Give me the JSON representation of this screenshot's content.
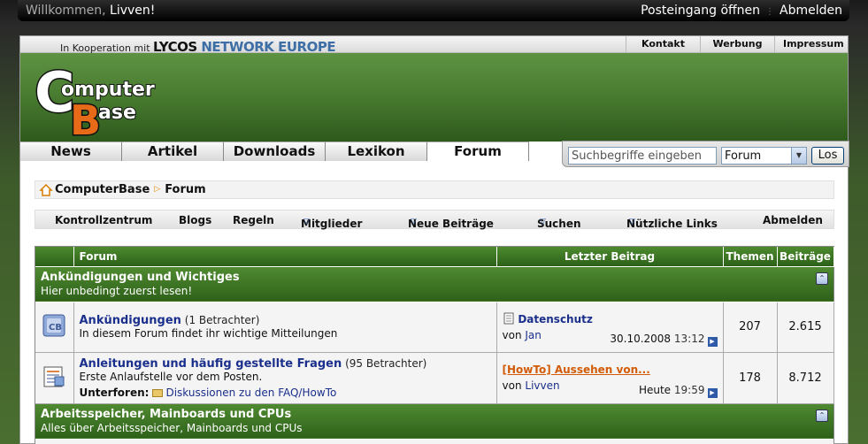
{
  "topbar": {
    "welcome_prefix": "Willkommen,",
    "username": "Livven!",
    "inbox": "Posteingang öffnen",
    "logout": "Abmelden"
  },
  "lycos": {
    "koop": "In Kooperation mit",
    "brand1": "LYCOS",
    "brand2": "NETWORK EUROPE",
    "links": [
      "Kontakt",
      "Werbung",
      "Impressum"
    ]
  },
  "logo": {
    "line1": "omputer",
    "line2": "ase",
    "c": "C",
    "b": "B"
  },
  "nav": {
    "tabs": [
      "News",
      "Artikel",
      "Downloads",
      "Lexikon",
      "Forum"
    ],
    "active": 4
  },
  "search": {
    "placeholder": "Suchbegriffe eingeben",
    "scope": "Forum",
    "button": "Los"
  },
  "breadcrumb": {
    "root": "ComputerBase",
    "current": "Forum"
  },
  "subnav": {
    "items": [
      "Kontrollzentrum",
      "Blogs",
      "Regeln",
      "Mitglieder",
      "Neue Beiträge",
      "Suchen",
      "Nützliche Links",
      "Abmelden"
    ]
  },
  "table": {
    "headers": {
      "forum": "Forum",
      "last": "Letzter Beitrag",
      "threads": "Themen",
      "posts": "Beiträge"
    },
    "categories": [
      {
        "title": "Ankündigungen und Wichtiges",
        "desc": "Hier unbedingt zuerst lesen!"
      },
      {
        "title": "Arbeitsspeicher, Mainboards und CPUs",
        "desc": "Alles über Arbeitsspeicher, Mainboards und CPUs"
      }
    ],
    "forums": [
      {
        "title": "Ankündigungen",
        "viewers": "(1 Betrachter)",
        "desc": "In diesem Forum findet ihr wichtige Mitteilungen",
        "last_title": "Datenschutz",
        "last_by_prefix": "von",
        "last_by": "Jan",
        "last_date": "30.10.2008",
        "last_time": "13:12",
        "threads": "207",
        "posts": "2.615"
      },
      {
        "title": "Anleitungen und häufig gestellte Fragen",
        "viewers": "(95 Betrachter)",
        "desc": "Erste Anlaufstelle vor dem Posten.",
        "subforen_label": "Unterforen:",
        "subforen_item": "Diskussionen zu den FAQ/HowTo",
        "last_title": "[HowTo] Aussehen von...",
        "last_by_prefix": "von",
        "last_by": "Livven",
        "last_date": "Heute",
        "last_time": "19:59",
        "threads": "178",
        "posts": "8.712"
      }
    ]
  }
}
